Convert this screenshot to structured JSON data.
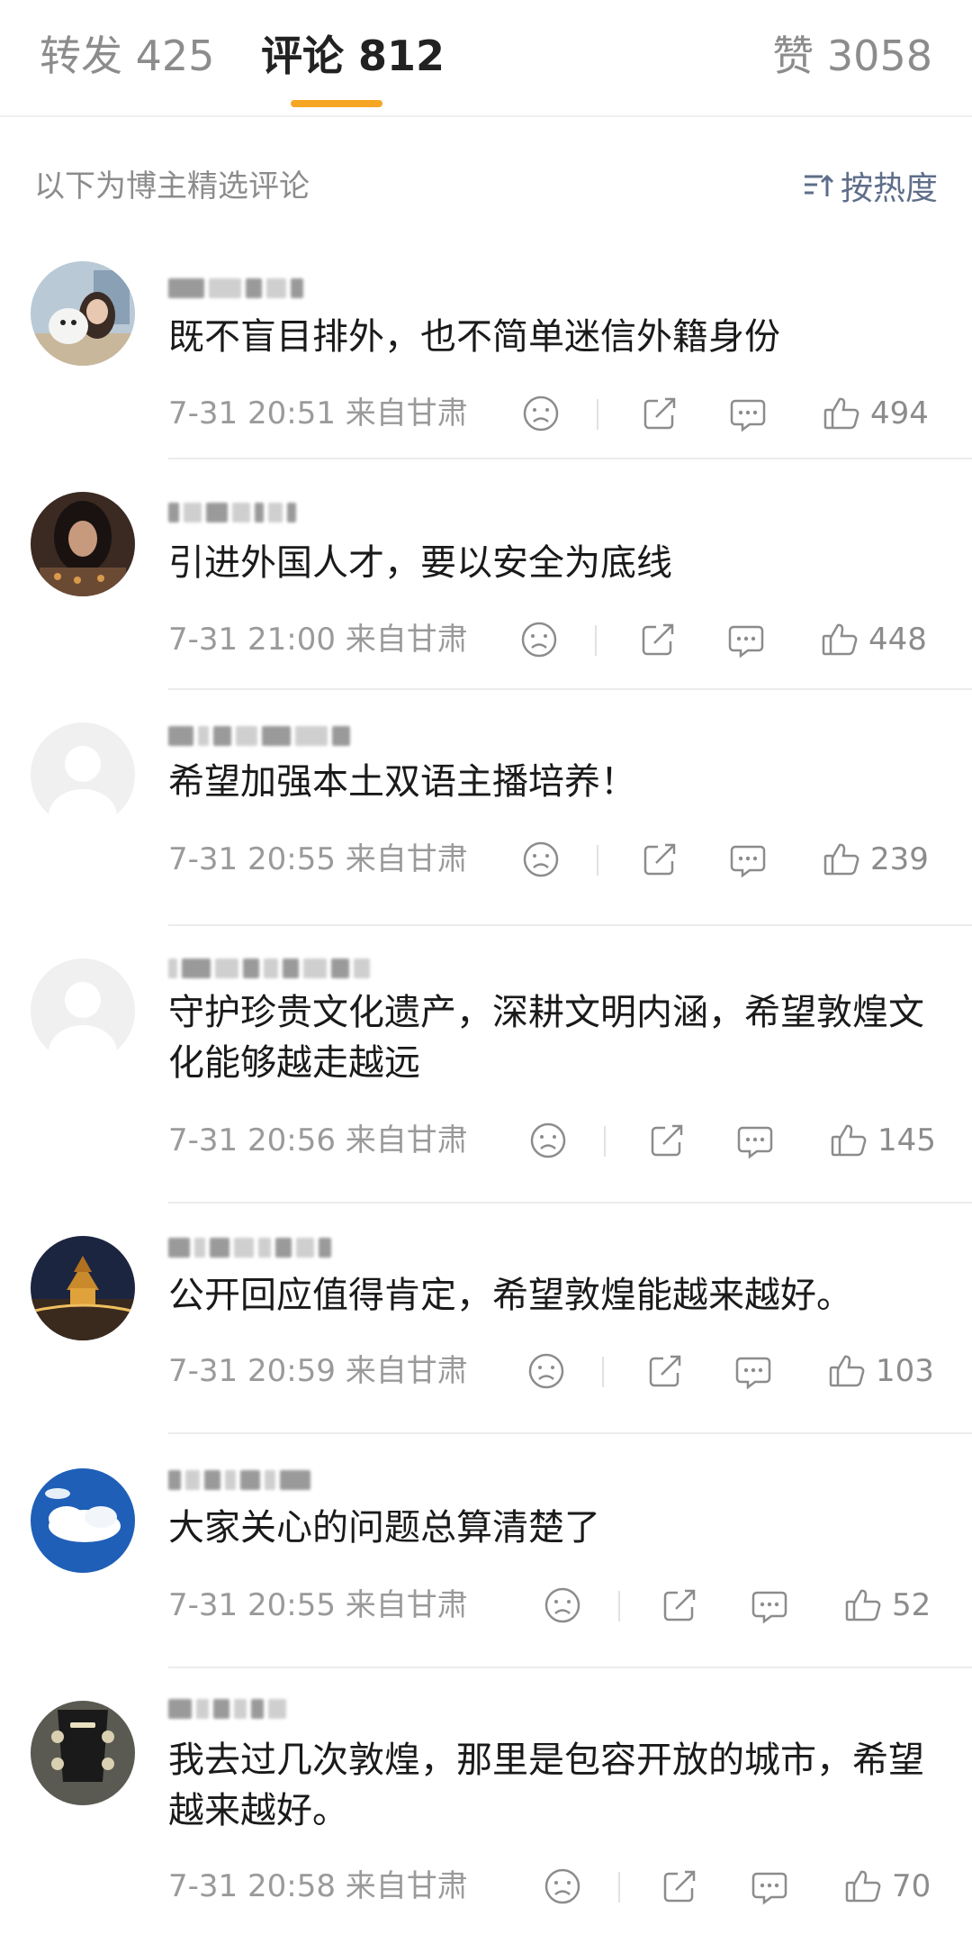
{
  "tabs": {
    "repost_label": "转发 425",
    "comment_label": "评论 812",
    "like_label": "赞 3058",
    "active_color": "#f5a623"
  },
  "section": {
    "title": "以下为博主精选评论",
    "sort_label": "按热度",
    "sort_icon": "sort-icon"
  },
  "comments": [
    {
      "text": "既不盲目排外，也不简单迷信外籍身份",
      "time": "7-31 20:51",
      "location": "来自甘肃",
      "likes": "494",
      "avatar": "photo-girl-with-dog"
    },
    {
      "text": "引进外国人才，要以安全为底线",
      "time": "7-31 21:00",
      "location": "来自甘肃",
      "likes": "448",
      "avatar": "photo-dark-portrait"
    },
    {
      "text": "希望加强本土双语主播培养！",
      "time": "7-31 20:55",
      "location": "来自甘肃",
      "likes": "239",
      "avatar": "default-user"
    },
    {
      "text": "守护珍贵文化遗产，深耕文明内涵，希望敦煌文化能够越走越远",
      "time": "7-31 20:56",
      "location": "来自甘肃",
      "likes": "145",
      "avatar": "default-user"
    },
    {
      "text": "公开回应值得肯定，希望敦煌能越来越好。",
      "time": "7-31 20:59",
      "location": "来自甘肃",
      "likes": "103",
      "avatar": "photo-night-tower"
    },
    {
      "text": "大家关心的问题总算清楚了",
      "time": "7-31 20:55",
      "location": "来自甘肃",
      "likes": "52",
      "avatar": "photo-blue-sky-clouds"
    },
    {
      "text": "我去过几次敦煌，那里是包容开放的城市，希望越来越好。",
      "time": "7-31 20:58",
      "location": "来自甘肃",
      "likes": "70",
      "avatar": "photo-guitar-headstock"
    }
  ],
  "icons": {
    "dislike": "sad-face-icon",
    "share": "share-icon",
    "reply": "comment-bubble-icon",
    "like": "thumbs-up-icon"
  }
}
